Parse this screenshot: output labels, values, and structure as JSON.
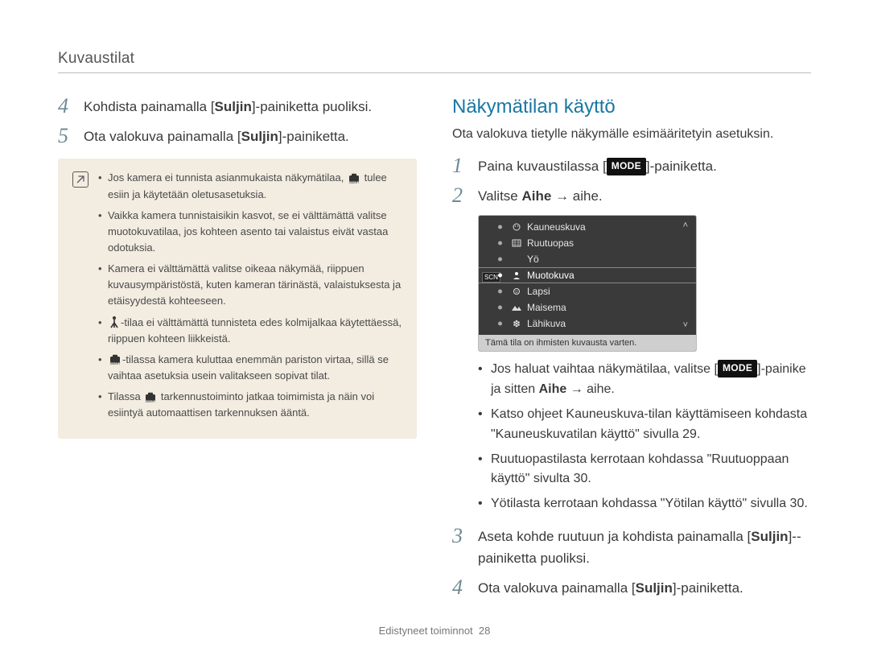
{
  "breadcrumb": "Kuvaustilat",
  "left": {
    "step4": {
      "num": "4",
      "text_parts": [
        "Kohdista painamalla [",
        "Suljin",
        "]-painiketta puoliksi."
      ]
    },
    "step5": {
      "num": "5",
      "text_parts": [
        "Ota valokuva painamalla [",
        "Suljin",
        "]-painiketta."
      ]
    },
    "note": {
      "bullet1_a": "Jos kamera ei tunnista asianmukaista näkymätilaa, ",
      "bullet1_b": " tulee esiin ja käytetään oletusasetuksia.",
      "bullet2": "Vaikka kamera tunnistaisikin kasvot, se ei välttämättä valitse muotokuvatilaa, jos kohteen asento tai valaistus eivät vastaa odotuksia.",
      "bullet3": "Kamera ei välttämättä valitse oikeaa näkymää, riippuen kuvausympäristöstä, kuten kameran tärinästä, valaistuksesta ja etäisyydestä kohteeseen.",
      "bullet4_a": "",
      "bullet4_b": "-tilaa ei välttämättä tunnisteta edes kolmijalkaa käytettäessä, riippuen kohteen liikkeistä.",
      "bullet5_a": "",
      "bullet5_b": "-tilassa kamera kuluttaa enemmän pariston virtaa, sillä se vaihtaa asetuksia usein valitakseen sopivat tilat.",
      "bullet6_a": "Tilassa ",
      "bullet6_b": " tarkennustoiminto jatkaa toimimista ja näin voi esiintyä automaattisen tarkennuksen ääntä."
    }
  },
  "right": {
    "heading": "Näkymätilan käyttö",
    "intro": "Ota valokuva tietylle näkymälle esimääritetyin asetuksin.",
    "step1": {
      "num": "1",
      "pre": "Paina kuvaustilassa [",
      "mode": "MODE",
      "post": "]-painiketta."
    },
    "step2": {
      "num": "2",
      "pre": "Valitse ",
      "strong": "Aihe",
      "post": " → aihe."
    },
    "panel": {
      "items": [
        {
          "label": "Kauneuskuva",
          "icon": "face"
        },
        {
          "label": "Ruutuopas",
          "icon": "frame"
        },
        {
          "label": "Yö",
          "icon": "moon"
        },
        {
          "label": "Muotokuva",
          "icon": "person",
          "selected": true
        },
        {
          "label": "Lapsi",
          "icon": "child"
        },
        {
          "label": "Maisema",
          "icon": "mountain"
        },
        {
          "label": "Lähikuva",
          "icon": "flower"
        }
      ],
      "footer": "Tämä tila on ihmisten kuvausta varten.",
      "left_badge": "SCN"
    },
    "bullets": {
      "b1_pre": "Jos haluat vaihtaa näkymätilaa, valitse [",
      "b1_mode": "MODE",
      "b1_mid": "]-painike ja sitten ",
      "b1_strong": "Aihe",
      "b1_post": " → aihe.",
      "b2": "Katso ohjeet Kauneuskuva-tilan käyttämiseen kohdasta \"Kauneuskuvatilan käyttö\" sivulla 29.",
      "b3": "Ruutuopastilasta kerrotaan kohdassa \"Ruutuoppaan käyttö\" sivulta 30.",
      "b4": "Yötilasta kerrotaan kohdassa \"Yötilan käyttö\" sivulla 30."
    },
    "step3": {
      "num": "3",
      "pre": "Aseta kohde ruutuun ja kohdista painamalla [",
      "strong": "Suljin",
      "post": "]-­painiketta puoliksi."
    },
    "step4": {
      "num": "4",
      "pre": "Ota valokuva painamalla [",
      "strong": "Suljin",
      "post": "]-painiketta."
    }
  },
  "footer": {
    "section": "Edistyneet toiminnot",
    "page": "28"
  }
}
